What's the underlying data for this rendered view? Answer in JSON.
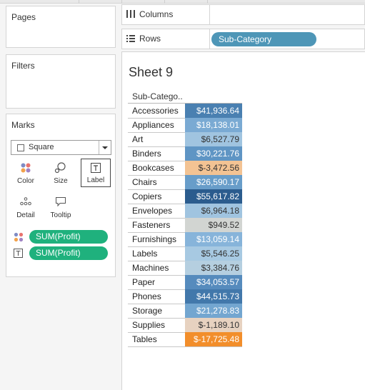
{
  "panes": {
    "pages_title": "Pages",
    "filters_title": "Filters",
    "marks_title": "Marks"
  },
  "marks": {
    "type_label": "Square",
    "buttons": [
      {
        "label": "Color",
        "icon": "color-dots-icon"
      },
      {
        "label": "Size",
        "icon": "size-icon"
      },
      {
        "label": "Label",
        "icon": "label-T-icon",
        "selected": true
      },
      {
        "label": "Detail",
        "icon": "detail-dots-icon"
      },
      {
        "label": "Tooltip",
        "icon": "tooltip-icon"
      }
    ],
    "pills": [
      {
        "label": "SUM(Profit)",
        "icon": "color-dots-icon"
      },
      {
        "label": "SUM(Profit)",
        "icon": "label-T-icon"
      }
    ]
  },
  "shelves": {
    "columns_label": "Columns",
    "rows_label": "Rows",
    "rows_pill": "Sub-Category"
  },
  "sheet": {
    "title": "Sheet 9",
    "column_header": "Sub-Catego..",
    "rows": [
      {
        "label": "Accessories",
        "value": "$41,936.64",
        "bg": "#4a80b1",
        "fg": "#ffffff"
      },
      {
        "label": "Appliances",
        "value": "$18,138.01",
        "bg": "#7aaad3",
        "fg": "#ffffff"
      },
      {
        "label": "Art",
        "value": "$6,527.79",
        "bg": "#a0c4e0",
        "fg": "#333333"
      },
      {
        "label": "Binders",
        "value": "$30,221.76",
        "bg": "#5f95c4",
        "fg": "#ffffff"
      },
      {
        "label": "Bookcases",
        "value": "$-3,472.56",
        "bg": "#f3c393",
        "fg": "#333333"
      },
      {
        "label": "Chairs",
        "value": "$26,590.17",
        "bg": "#689dc9",
        "fg": "#ffffff"
      },
      {
        "label": "Copiers",
        "value": "$55,617.82",
        "bg": "#2b5c8e",
        "fg": "#ffffff"
      },
      {
        "label": "Envelopes",
        "value": "$6,964.18",
        "bg": "#a0c4e0",
        "fg": "#333333"
      },
      {
        "label": "Fasteners",
        "value": "$949.52",
        "bg": "#d2d5d2",
        "fg": "#333333"
      },
      {
        "label": "Furnishings",
        "value": "$13,059.14",
        "bg": "#87b4da",
        "fg": "#ffffff"
      },
      {
        "label": "Labels",
        "value": "$5,546.25",
        "bg": "#a7c9e2",
        "fg": "#333333"
      },
      {
        "label": "Machines",
        "value": "$3,384.76",
        "bg": "#b5cfe0",
        "fg": "#333333"
      },
      {
        "label": "Paper",
        "value": "$34,053.57",
        "bg": "#568bbd",
        "fg": "#ffffff"
      },
      {
        "label": "Phones",
        "value": "$44,515.73",
        "bg": "#4278ab",
        "fg": "#ffffff"
      },
      {
        "label": "Storage",
        "value": "$21,278.83",
        "bg": "#73a6d0",
        "fg": "#ffffff"
      },
      {
        "label": "Supplies",
        "value": "$-1,189.10",
        "bg": "#e7d2c0",
        "fg": "#333333"
      },
      {
        "label": "Tables",
        "value": "$-17,725.48",
        "bg": "#f28e2b",
        "fg": "#ffffff"
      }
    ]
  }
}
